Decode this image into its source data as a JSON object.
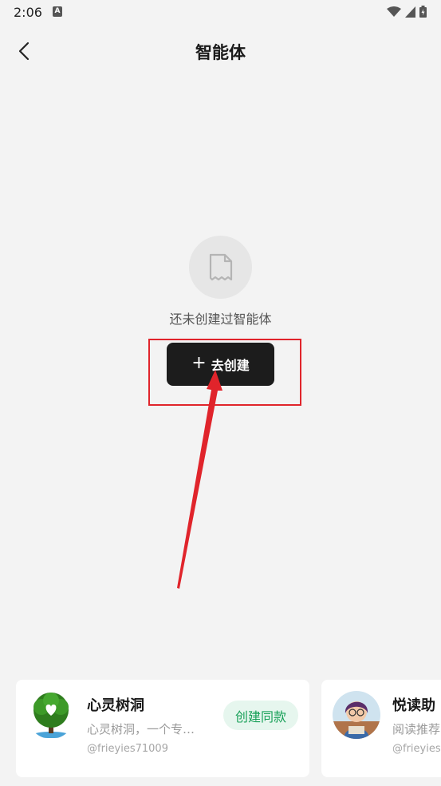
{
  "status_bar": {
    "time": "2:06",
    "notification_icon": "A"
  },
  "header": {
    "title": "智能体",
    "back_icon": "chevron-left-icon"
  },
  "empty_state": {
    "icon": "document-icon",
    "message": "还未创建过智能体",
    "create_label": "去创建",
    "create_icon": "plus-icon"
  },
  "annotation": {
    "highlight_color": "#e0242b"
  },
  "cards": [
    {
      "name": "心灵树洞",
      "desc": "心灵树洞，一个专…",
      "author": "@frieyies71009",
      "action_label": "创建同款",
      "avatar": "tree-heart-avatar"
    },
    {
      "name": "悦读助",
      "desc": "阅读推荐",
      "author": "@frieyies",
      "avatar": "reader-avatar"
    }
  ],
  "colors": {
    "background": "#f3f3f3",
    "button_dark": "#1c1c1c",
    "accent_green": "#18a058"
  }
}
